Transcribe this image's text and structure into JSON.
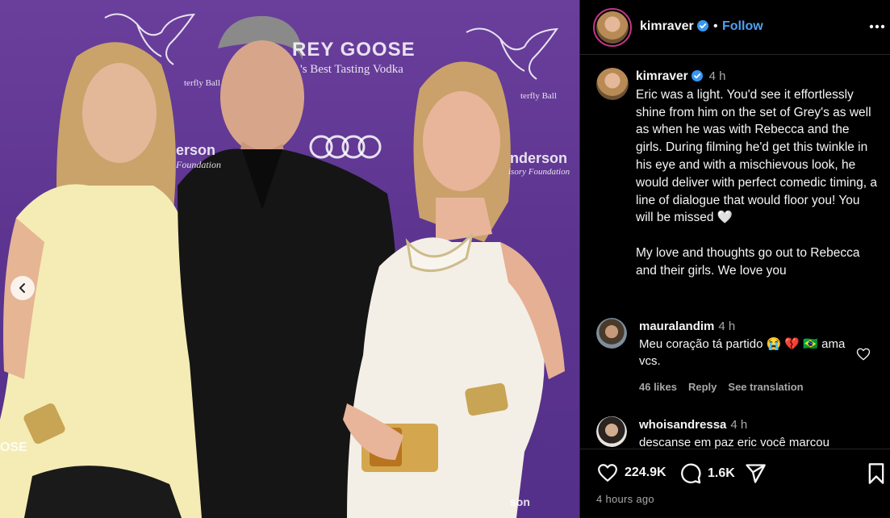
{
  "photo": {
    "backdrop": {
      "goose": "REY GOOSE",
      "vodka": "'s Best Tasting Vodka",
      "ball_left": "terfly Ball",
      "ball_right": "terfly Ball",
      "anderson_left": "erson",
      "foundation_left": "Foundation",
      "anderson_right": "nderson",
      "foundation_right": "isory Foundation",
      "goose_bottom": "OSE",
      "anderson_bottom": "son"
    }
  },
  "header": {
    "username": "kimraver",
    "separator": "•",
    "follow_label": "Follow"
  },
  "caption": {
    "username": "kimraver",
    "time": "4 h",
    "paragraph1": "Eric was a light. You'd see it effortlessly shine from him on the set of Grey's as well as when he was with Rebecca and the girls. During filming he'd get this twinkle in his eye and with a mischievous look, he would deliver with perfect comedic timing, a line of dialogue that would floor you! You will be missed 🤍",
    "paragraph2": "My love and thoughts go out to Rebecca and their girls. We love you"
  },
  "comments": [
    {
      "username": "mauralandim",
      "time": "4 h",
      "text": "Meu coração tá partido 😭 💔 🇧🇷 ama vcs.",
      "likes": "46 likes",
      "reply": "Reply",
      "translate": "See translation"
    },
    {
      "username": "whoisandressa",
      "time": "4 h",
      "text": "descanse em paz eric você marcou"
    }
  ],
  "actions": {
    "likes": "224.9K",
    "comments": "1.6K",
    "time_ago": "4 hours ago"
  },
  "colors": {
    "accent": "#4ea1f5",
    "verified": "#3897f0",
    "backdrop": "#5d3590"
  }
}
